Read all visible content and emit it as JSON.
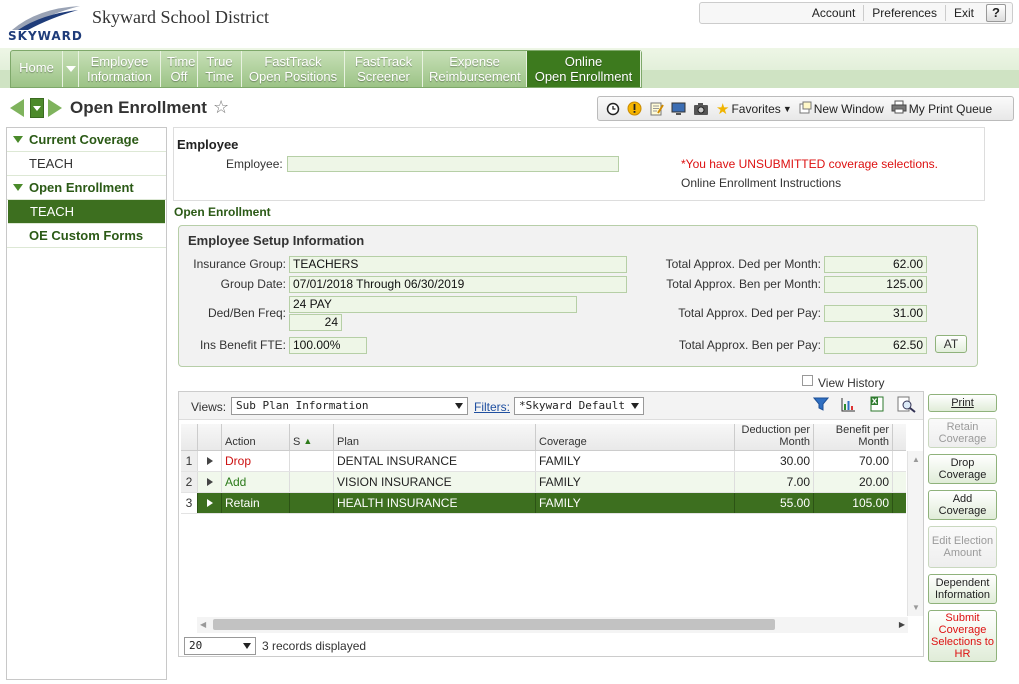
{
  "header": {
    "logo": "SKYWARD",
    "district": "Skyward School District",
    "links": [
      "Account",
      "Preferences",
      "Exit"
    ],
    "help": "?"
  },
  "nav": {
    "home": "Home",
    "tabs": [
      {
        "l1": "Employee",
        "l2": "Information"
      },
      {
        "l1": "Time",
        "l2": "Off"
      },
      {
        "l1": "True",
        "l2": "Time"
      },
      {
        "l1": "FastTrack",
        "l2": "Open Positions"
      },
      {
        "l1": "FastTrack",
        "l2": "Screener"
      },
      {
        "l1": "Expense",
        "l2": "Reimbursement"
      },
      {
        "l1": "Online",
        "l2": "Open Enrollment"
      }
    ]
  },
  "title": "Open Enrollment",
  "toolbar": {
    "favorites": "Favorites",
    "new_window": "New Window",
    "print_queue": "My Print Queue"
  },
  "sidebar": {
    "current_coverage": "Current Coverage",
    "current_teach": "TEACH",
    "open_enrollment": "Open Enrollment",
    "oe_teach": "TEACH",
    "oe_custom_forms": "OE Custom Forms"
  },
  "employee": {
    "heading": "Employee",
    "label": "Employee:",
    "value": "",
    "unsubmitted": "*You have UNSUBMITTED coverage selections.",
    "instructions": "Online Enrollment Instructions"
  },
  "oe_heading": "Open Enrollment",
  "setup": {
    "heading": "Employee Setup Information",
    "insurance_group_label": "Insurance Group:",
    "insurance_group": "TEACHERS",
    "group_date_label": "Group Date:",
    "group_date": "07/01/2018 Through 06/30/2019",
    "ded_ben_label": "Ded/Ben Freq:",
    "ded_ben_freq": "24 PAY",
    "ded_ben_num": "24",
    "fte_label": "Ins Benefit FTE:",
    "fte": "100.00%",
    "ded_month_label": "Total Approx. Ded per Month:",
    "ded_month": "62.00",
    "ben_month_label": "Total Approx. Ben per Month:",
    "ben_month": "125.00",
    "ded_pay_label": "Total Approx. Ded per Pay:",
    "ded_pay": "31.00",
    "ben_pay_label": "Total Approx. Ben per Pay:",
    "ben_pay": "62.50",
    "at_button": "AT"
  },
  "view_history": "View History",
  "grid": {
    "views_label": "Views:",
    "views_value": "Sub Plan Information",
    "filters_label": "Filters:",
    "filters_value": "*Skyward Default",
    "columns": {
      "action": "Action",
      "s": "S",
      "plan": "Plan",
      "coverage": "Coverage",
      "deduction": "Deduction per Month",
      "benefit": "Benefit per Month"
    },
    "rows": [
      {
        "n": "1",
        "action": "Drop",
        "plan": "DENTAL INSURANCE",
        "coverage": "FAMILY",
        "ded": "30.00",
        "ben": "70.00",
        "color": "#cc1111"
      },
      {
        "n": "2",
        "action": "Add",
        "plan": "VISION INSURANCE",
        "coverage": "FAMILY",
        "ded": "7.00",
        "ben": "20.00",
        "color": "#2b7a1a"
      },
      {
        "n": "3",
        "action": "Retain",
        "plan": "HEALTH INSURANCE",
        "coverage": "FAMILY",
        "ded": "55.00",
        "ben": "105.00",
        "color": "#ffffff"
      }
    ],
    "page_size": "20",
    "records": "3 records displayed"
  },
  "buttons": {
    "print": "Print",
    "retain": "Retain Coverage",
    "drop": "Drop Coverage",
    "add": "Add Coverage",
    "edit": "Edit Election Amount",
    "dependent": "Dependent Information",
    "submit": "Submit Coverage Selections to HR"
  },
  "colors": {
    "nav_active": "#3d7a1e",
    "sidebar_active": "#3d6f1f",
    "warning": "#d11111"
  }
}
